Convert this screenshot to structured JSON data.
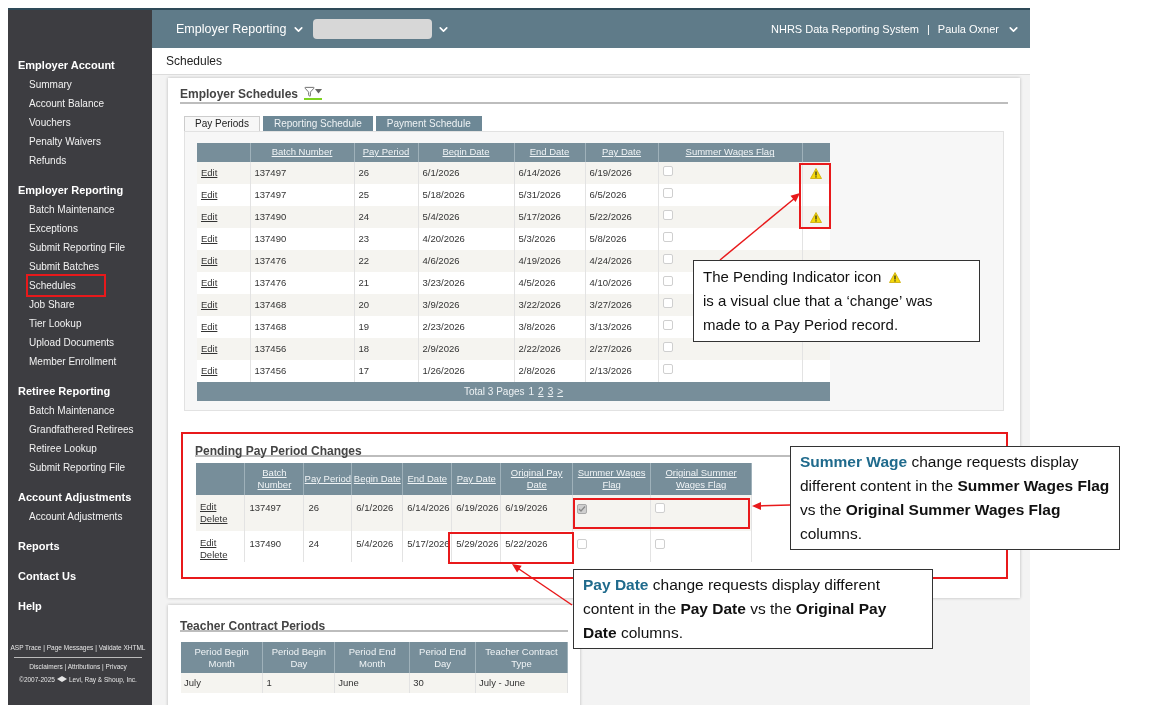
{
  "top_bar": {
    "menu": "Employer Reporting",
    "system_name": "NHRS Data Reporting System",
    "separator": "|",
    "user": "Paula Oxner"
  },
  "sidebar": {
    "sections": [
      {
        "title": "Employer Account",
        "items": [
          {
            "label": "Summary",
            "selected": false
          },
          {
            "label": "Account Balance",
            "selected": false
          },
          {
            "label": "Vouchers",
            "selected": false
          },
          {
            "label": "Penalty Waivers",
            "selected": false
          },
          {
            "label": "Refunds",
            "selected": false
          }
        ]
      },
      {
        "title": "Employer Reporting",
        "items": [
          {
            "label": "Batch Maintenance",
            "selected": false
          },
          {
            "label": "Exceptions",
            "selected": false
          },
          {
            "label": "Submit Reporting File",
            "selected": false
          },
          {
            "label": "Submit Batches",
            "selected": false
          },
          {
            "label": "Schedules",
            "selected": true
          },
          {
            "label": "Job Share",
            "selected": false
          },
          {
            "label": "Tier Lookup",
            "selected": false
          },
          {
            "label": "Upload Documents",
            "selected": false
          },
          {
            "label": "Member Enrollment",
            "selected": false
          }
        ]
      },
      {
        "title": "Retiree Reporting",
        "items": [
          {
            "label": "Batch Maintenance",
            "selected": false
          },
          {
            "label": "Grandfathered Retirees",
            "selected": false
          },
          {
            "label": "Retiree Lookup",
            "selected": false
          },
          {
            "label": "Submit Reporting File",
            "selected": false
          }
        ]
      },
      {
        "title": "Account Adjustments",
        "items": [
          {
            "label": "Account Adjustments",
            "selected": false
          }
        ]
      },
      {
        "title": "Reports"
      },
      {
        "title": "Contact Us"
      },
      {
        "title": "Help"
      }
    ],
    "footer": {
      "dev_links": "ASP Trace | Page Messages | Validate XHTML",
      "legal_links": "Disclaimers | Attributions | Privacy",
      "copyright_years": "©2007-2025",
      "company": "Levi, Ray & Shoup, Inc."
    }
  },
  "breadcrumb": "Schedules",
  "employer_schedules": {
    "title": "Employer Schedules",
    "tabs": [
      {
        "label": "Pay Periods",
        "selected": true
      },
      {
        "label": "Reporting Schedule",
        "selected": false
      },
      {
        "label": "Payment Schedule",
        "selected": false
      }
    ],
    "columns": [
      "Batch Number",
      "Pay Period",
      "Begin Date",
      "End Date",
      "Pay Date",
      "Summer Wages Flag"
    ],
    "rows": [
      {
        "action": "Edit",
        "batch_number": "137497",
        "pay_period": "26",
        "begin_date": "6/1/2026",
        "end_date": "6/14/2026",
        "pay_date": "6/19/2026",
        "summer_wages_flag": false,
        "pending": true
      },
      {
        "action": "Edit",
        "batch_number": "137497",
        "pay_period": "25",
        "begin_date": "5/18/2026",
        "end_date": "5/31/2026",
        "pay_date": "6/5/2026",
        "summer_wages_flag": false,
        "pending": false
      },
      {
        "action": "Edit",
        "batch_number": "137490",
        "pay_period": "24",
        "begin_date": "5/4/2026",
        "end_date": "5/17/2026",
        "pay_date": "5/22/2026",
        "summer_wages_flag": false,
        "pending": true
      },
      {
        "action": "Edit",
        "batch_number": "137490",
        "pay_period": "23",
        "begin_date": "4/20/2026",
        "end_date": "5/3/2026",
        "pay_date": "5/8/2026",
        "summer_wages_flag": false,
        "pending": false
      },
      {
        "action": "Edit",
        "batch_number": "137476",
        "pay_period": "22",
        "begin_date": "4/6/2026",
        "end_date": "4/19/2026",
        "pay_date": "4/24/2026",
        "summer_wages_flag": false,
        "pending": false
      },
      {
        "action": "Edit",
        "batch_number": "137476",
        "pay_period": "21",
        "begin_date": "3/23/2026",
        "end_date": "4/5/2026",
        "pay_date": "4/10/2026",
        "summer_wages_flag": false
      },
      {
        "action": "Edit",
        "batch_number": "137468",
        "pay_period": "20",
        "begin_date": "3/9/2026",
        "end_date": "3/22/2026",
        "pay_date": "3/27/2026",
        "summer_wages_flag": false
      },
      {
        "action": "Edit",
        "batch_number": "137468",
        "pay_period": "19",
        "begin_date": "2/23/2026",
        "end_date": "3/8/2026",
        "pay_date": "3/13/2026",
        "summer_wages_flag": false
      },
      {
        "action": "Edit",
        "batch_number": "137456",
        "pay_period": "18",
        "begin_date": "2/9/2026",
        "end_date": "2/22/2026",
        "pay_date": "2/27/2026",
        "summer_wages_flag": false
      },
      {
        "action": "Edit",
        "batch_number": "137456",
        "pay_period": "17",
        "begin_date": "1/26/2026",
        "end_date": "2/8/2026",
        "pay_date": "2/13/2026",
        "summer_wages_flag": false,
        "pending": false
      }
    ],
    "pager": {
      "summary": "Total 3 Pages",
      "pages": [
        {
          "label": "1",
          "selected": true
        },
        {
          "label": "2",
          "selected": false
        },
        {
          "label": "3",
          "selected": false
        },
        {
          "label": ">",
          "selected": false
        }
      ]
    }
  },
  "pending_changes": {
    "title": "Pending Pay Period Changes",
    "columns": [
      "Batch Number",
      "Pay Period",
      "Begin Date",
      "End Date",
      "Pay Date",
      "Original Pay Date",
      "Summer Wages Flag",
      "Original Summer Wages Flag"
    ],
    "rows": [
      {
        "actions": [
          "Edit",
          "Delete"
        ],
        "batch_number": "137497",
        "pay_period": "26",
        "begin_date": "6/1/2026",
        "end_date": "6/14/2026",
        "pay_date": "6/19/2026",
        "original_pay_date": "6/19/2026",
        "summer_wages_flag": true,
        "original_summer_wages_flag": false
      },
      {
        "actions": [
          "Edit",
          "Delete"
        ],
        "batch_number": "137490",
        "pay_period": "24",
        "begin_date": "5/4/2026",
        "end_date": "5/17/2026",
        "pay_date": "5/29/2026",
        "original_pay_date": "5/22/2026",
        "summer_wages_flag": false,
        "original_summer_wages_flag": false
      }
    ]
  },
  "teacher_contract_periods": {
    "title": "Teacher Contract Periods",
    "columns": [
      "Period Begin Month",
      "Period Begin Day",
      "Period End Month",
      "Period End Day",
      "Teacher Contract Type"
    ],
    "rows": [
      [
        "July",
        "1",
        "June",
        "30",
        "July - June"
      ]
    ]
  },
  "callouts": [
    {
      "kind": "icon",
      "text_before_icon": "The Pending Indicator icon",
      "text_after_icon": "is a visual clue that a ‘change’ was made to a Pay Period record."
    },
    {
      "kind": "lead",
      "lead": "Summer Wage",
      "text": "change requests display different content in the **Summer Wages Flag** vs the **Original Summer Wages Flag** columns."
    },
    {
      "kind": "lead",
      "lead": "Pay Date",
      "text": "change requests display different content in the **Pay Date** vs the **Original Pay Date** columns."
    }
  ]
}
